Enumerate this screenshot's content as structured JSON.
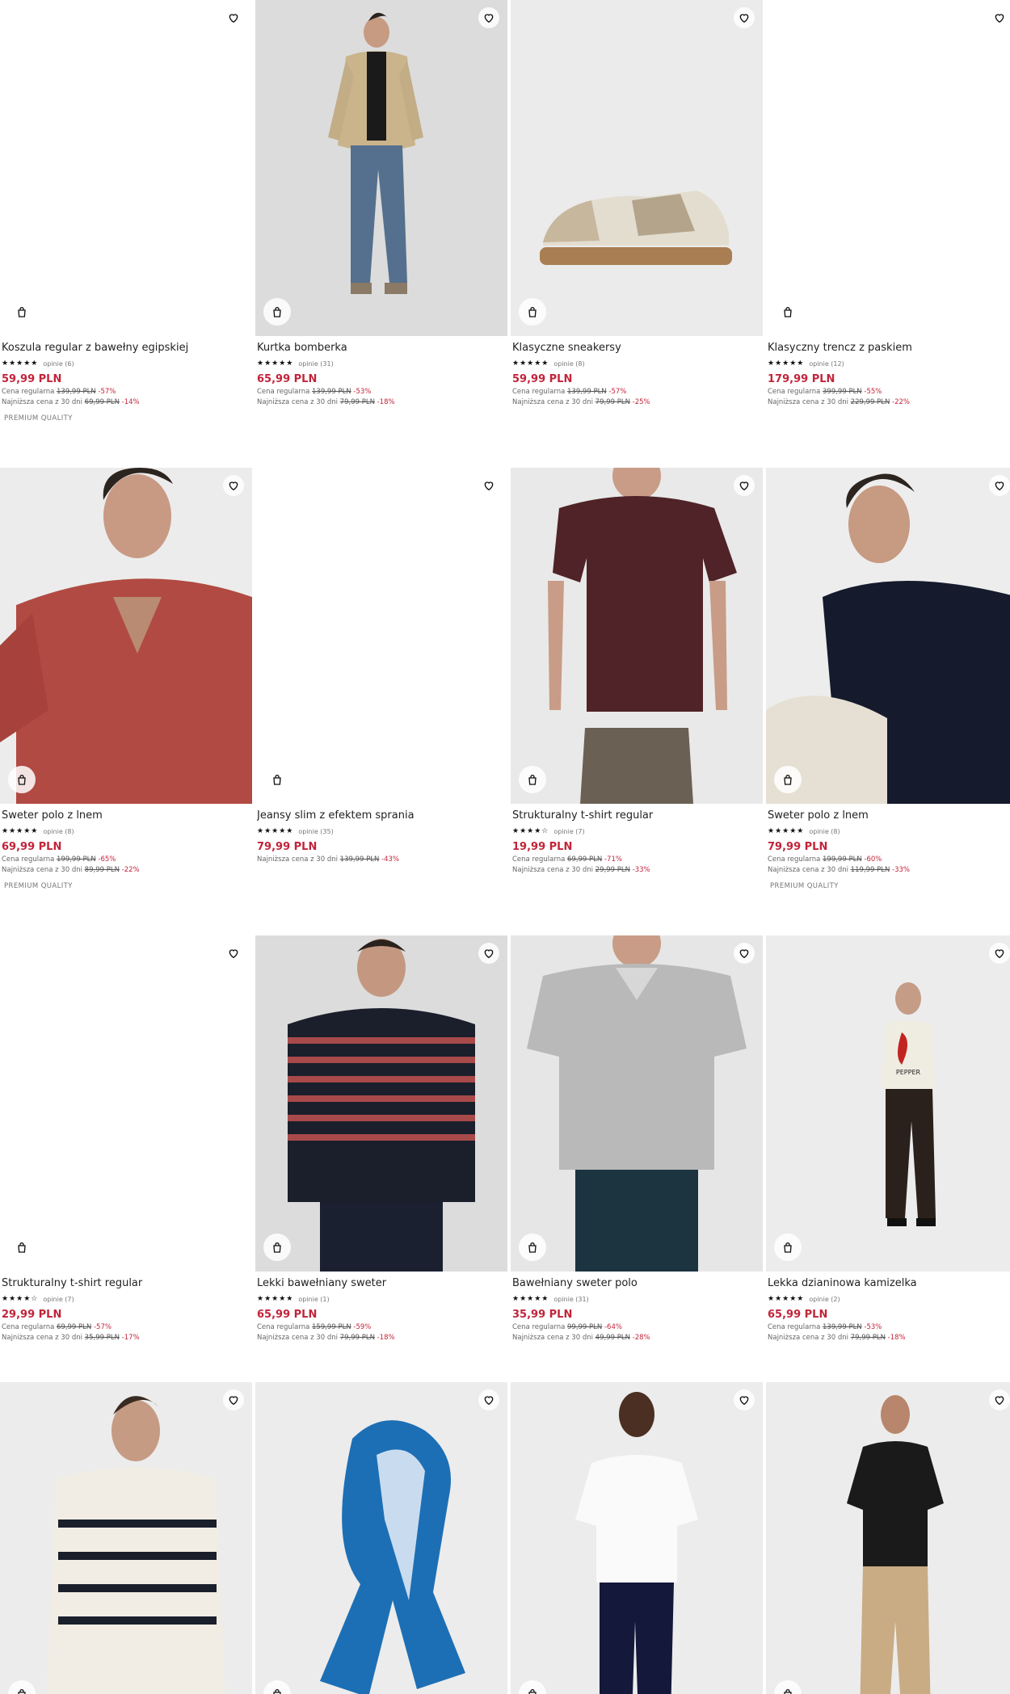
{
  "products": [
    {
      "title": "Koszula regular z bawełny egipskiej",
      "stars": "★★★★★",
      "reviews": "opinie (6)",
      "price": "59,99 PLN",
      "regular_label": "Cena regularna",
      "regular_old": "139,99 PLN",
      "regular_disc": "-57%",
      "lowest_label": "Najniższa cena z 30 dni",
      "lowest_old": "69,99 PLN",
      "lowest_disc": "-14%",
      "badge": "PREMIUM QUALITY",
      "image": "blank"
    },
    {
      "title": "Kurtka bomberka",
      "stars": "★★★★★",
      "reviews": "opinie (31)",
      "price": "65,99 PLN",
      "regular_label": "Cena regularna",
      "regular_old": "139,99 PLN",
      "regular_disc": "-53%",
      "lowest_label": "Najniższa cena z 30 dni",
      "lowest_old": "79,99 PLN",
      "lowest_disc": "-18%",
      "badge": "",
      "image": "bomber"
    },
    {
      "title": "Klasyczne sneakersy",
      "stars": "★★★★★",
      "reviews": "opinie (8)",
      "price": "59,99 PLN",
      "regular_label": "Cena regularna",
      "regular_old": "139,99 PLN",
      "regular_disc": "-57%",
      "lowest_label": "Najniższa cena z 30 dni",
      "lowest_old": "79,99 PLN",
      "lowest_disc": "-25%",
      "badge": "",
      "image": "sneaker"
    },
    {
      "title": "Klasyczny trencz z paskiem",
      "stars": "★★★★★",
      "reviews": "opinie (12)",
      "price": "179,99 PLN",
      "regular_label": "Cena regularna",
      "regular_old": "399,99 PLN",
      "regular_disc": "-55%",
      "lowest_label": "Najniższa cena z 30 dni",
      "lowest_old": "229,99 PLN",
      "lowest_disc": "-22%",
      "badge": "",
      "image": "blank"
    },
    {
      "title": "Sweter polo z lnem",
      "stars": "★★★★★",
      "reviews": "opinie (8)",
      "price": "69,99 PLN",
      "regular_label": "Cena regularna",
      "regular_old": "199,99 PLN",
      "regular_disc": "-65%",
      "lowest_label": "Najniższa cena z 30 dni",
      "lowest_old": "89,99 PLN",
      "lowest_disc": "-22%",
      "badge": "PREMIUM QUALITY",
      "image": "redpolo"
    },
    {
      "title": "Jeansy slim z efektem sprania",
      "stars": "★★★★★",
      "reviews": "opinie (35)",
      "price": "79,99 PLN",
      "regular_label": "",
      "regular_old": "",
      "regular_disc": "",
      "lowest_label": "Najniższa cena z 30 dni",
      "lowest_old": "139,99 PLN",
      "lowest_disc": "-43%",
      "badge": "",
      "image": "blank"
    },
    {
      "title": "Strukturalny t-shirt regular",
      "stars": "★★★★☆",
      "reviews": "opinie (7)",
      "price": "19,99 PLN",
      "regular_label": "Cena regularna",
      "regular_old": "69,99 PLN",
      "regular_disc": "-71%",
      "lowest_label": "Najniższa cena z 30 dni",
      "lowest_old": "29,99 PLN",
      "lowest_disc": "-33%",
      "badge": "",
      "image": "burgundytee"
    },
    {
      "title": "Sweter polo z lnem",
      "stars": "★★★★★",
      "reviews": "opinie (8)",
      "price": "79,99 PLN",
      "regular_label": "Cena regularna",
      "regular_old": "199,99 PLN",
      "regular_disc": "-60%",
      "lowest_label": "Najniższa cena z 30 dni",
      "lowest_old": "119,99 PLN",
      "lowest_disc": "-33%",
      "badge": "PREMIUM QUALITY",
      "image": "navypolo"
    },
    {
      "title": "Strukturalny t-shirt regular",
      "stars": "★★★★☆",
      "reviews": "opinie (7)",
      "price": "29,99 PLN",
      "regular_label": "Cena regularna",
      "regular_old": "69,99 PLN",
      "regular_disc": "-57%",
      "lowest_label": "Najniższa cena z 30 dni",
      "lowest_old": "35,99 PLN",
      "lowest_disc": "-17%",
      "badge": "",
      "image": "blank"
    },
    {
      "title": "Lekki bawełniany sweter",
      "stars": "★★★★★",
      "reviews": "opinie (1)",
      "price": "65,99 PLN",
      "regular_label": "Cena regularna",
      "regular_old": "159,99 PLN",
      "regular_disc": "-59%",
      "lowest_label": "Najniższa cena z 30 dni",
      "lowest_old": "79,99 PLN",
      "lowest_disc": "-18%",
      "badge": "",
      "image": "stripesweater"
    },
    {
      "title": "Bawełniany sweter polo",
      "stars": "★★★★★",
      "reviews": "opinie (31)",
      "price": "35,99 PLN",
      "regular_label": "Cena regularna",
      "regular_old": "99,99 PLN",
      "regular_disc": "-64%",
      "lowest_label": "Najniższa cena z 30 dni",
      "lowest_old": "49,99 PLN",
      "lowest_disc": "-28%",
      "badge": "",
      "image": "greypolo"
    },
    {
      "title": "Lekka dzianinowa kamizelka",
      "stars": "★★★★★",
      "reviews": "opinie (2)",
      "price": "65,99 PLN",
      "regular_label": "Cena regularna",
      "regular_old": "139,99 PLN",
      "regular_disc": "-53%",
      "lowest_label": "Najniższa cena z 30 dni",
      "lowest_old": "79,99 PLN",
      "lowest_disc": "-18%",
      "badge": "",
      "image": "pepper"
    },
    {
      "title": "",
      "stars": "",
      "reviews": "",
      "price": "",
      "regular_label": "",
      "regular_old": "",
      "regular_disc": "",
      "lowest_label": "",
      "lowest_old": "",
      "lowest_disc": "",
      "badge": "",
      "image": "stripedpolo"
    },
    {
      "title": "",
      "stars": "",
      "reviews": "",
      "price": "",
      "regular_label": "",
      "regular_old": "",
      "regular_disc": "",
      "lowest_label": "",
      "lowest_old": "",
      "lowest_disc": "",
      "badge": "",
      "image": "scarf"
    },
    {
      "title": "",
      "stars": "",
      "reviews": "",
      "price": "",
      "regular_label": "",
      "regular_old": "",
      "regular_disc": "",
      "lowest_label": "",
      "lowest_old": "",
      "lowest_disc": "",
      "badge": "",
      "image": "whitetee"
    },
    {
      "title": "",
      "stars": "",
      "reviews": "",
      "price": "",
      "regular_label": "",
      "regular_old": "",
      "regular_disc": "",
      "lowest_label": "",
      "lowest_old": "",
      "lowest_disc": "",
      "badge": "",
      "image": "blacktee"
    }
  ],
  "print_text": "PEPPER",
  "colors": {
    "price": "#c2243a",
    "discount": "#c2243a",
    "text": "#222222"
  }
}
